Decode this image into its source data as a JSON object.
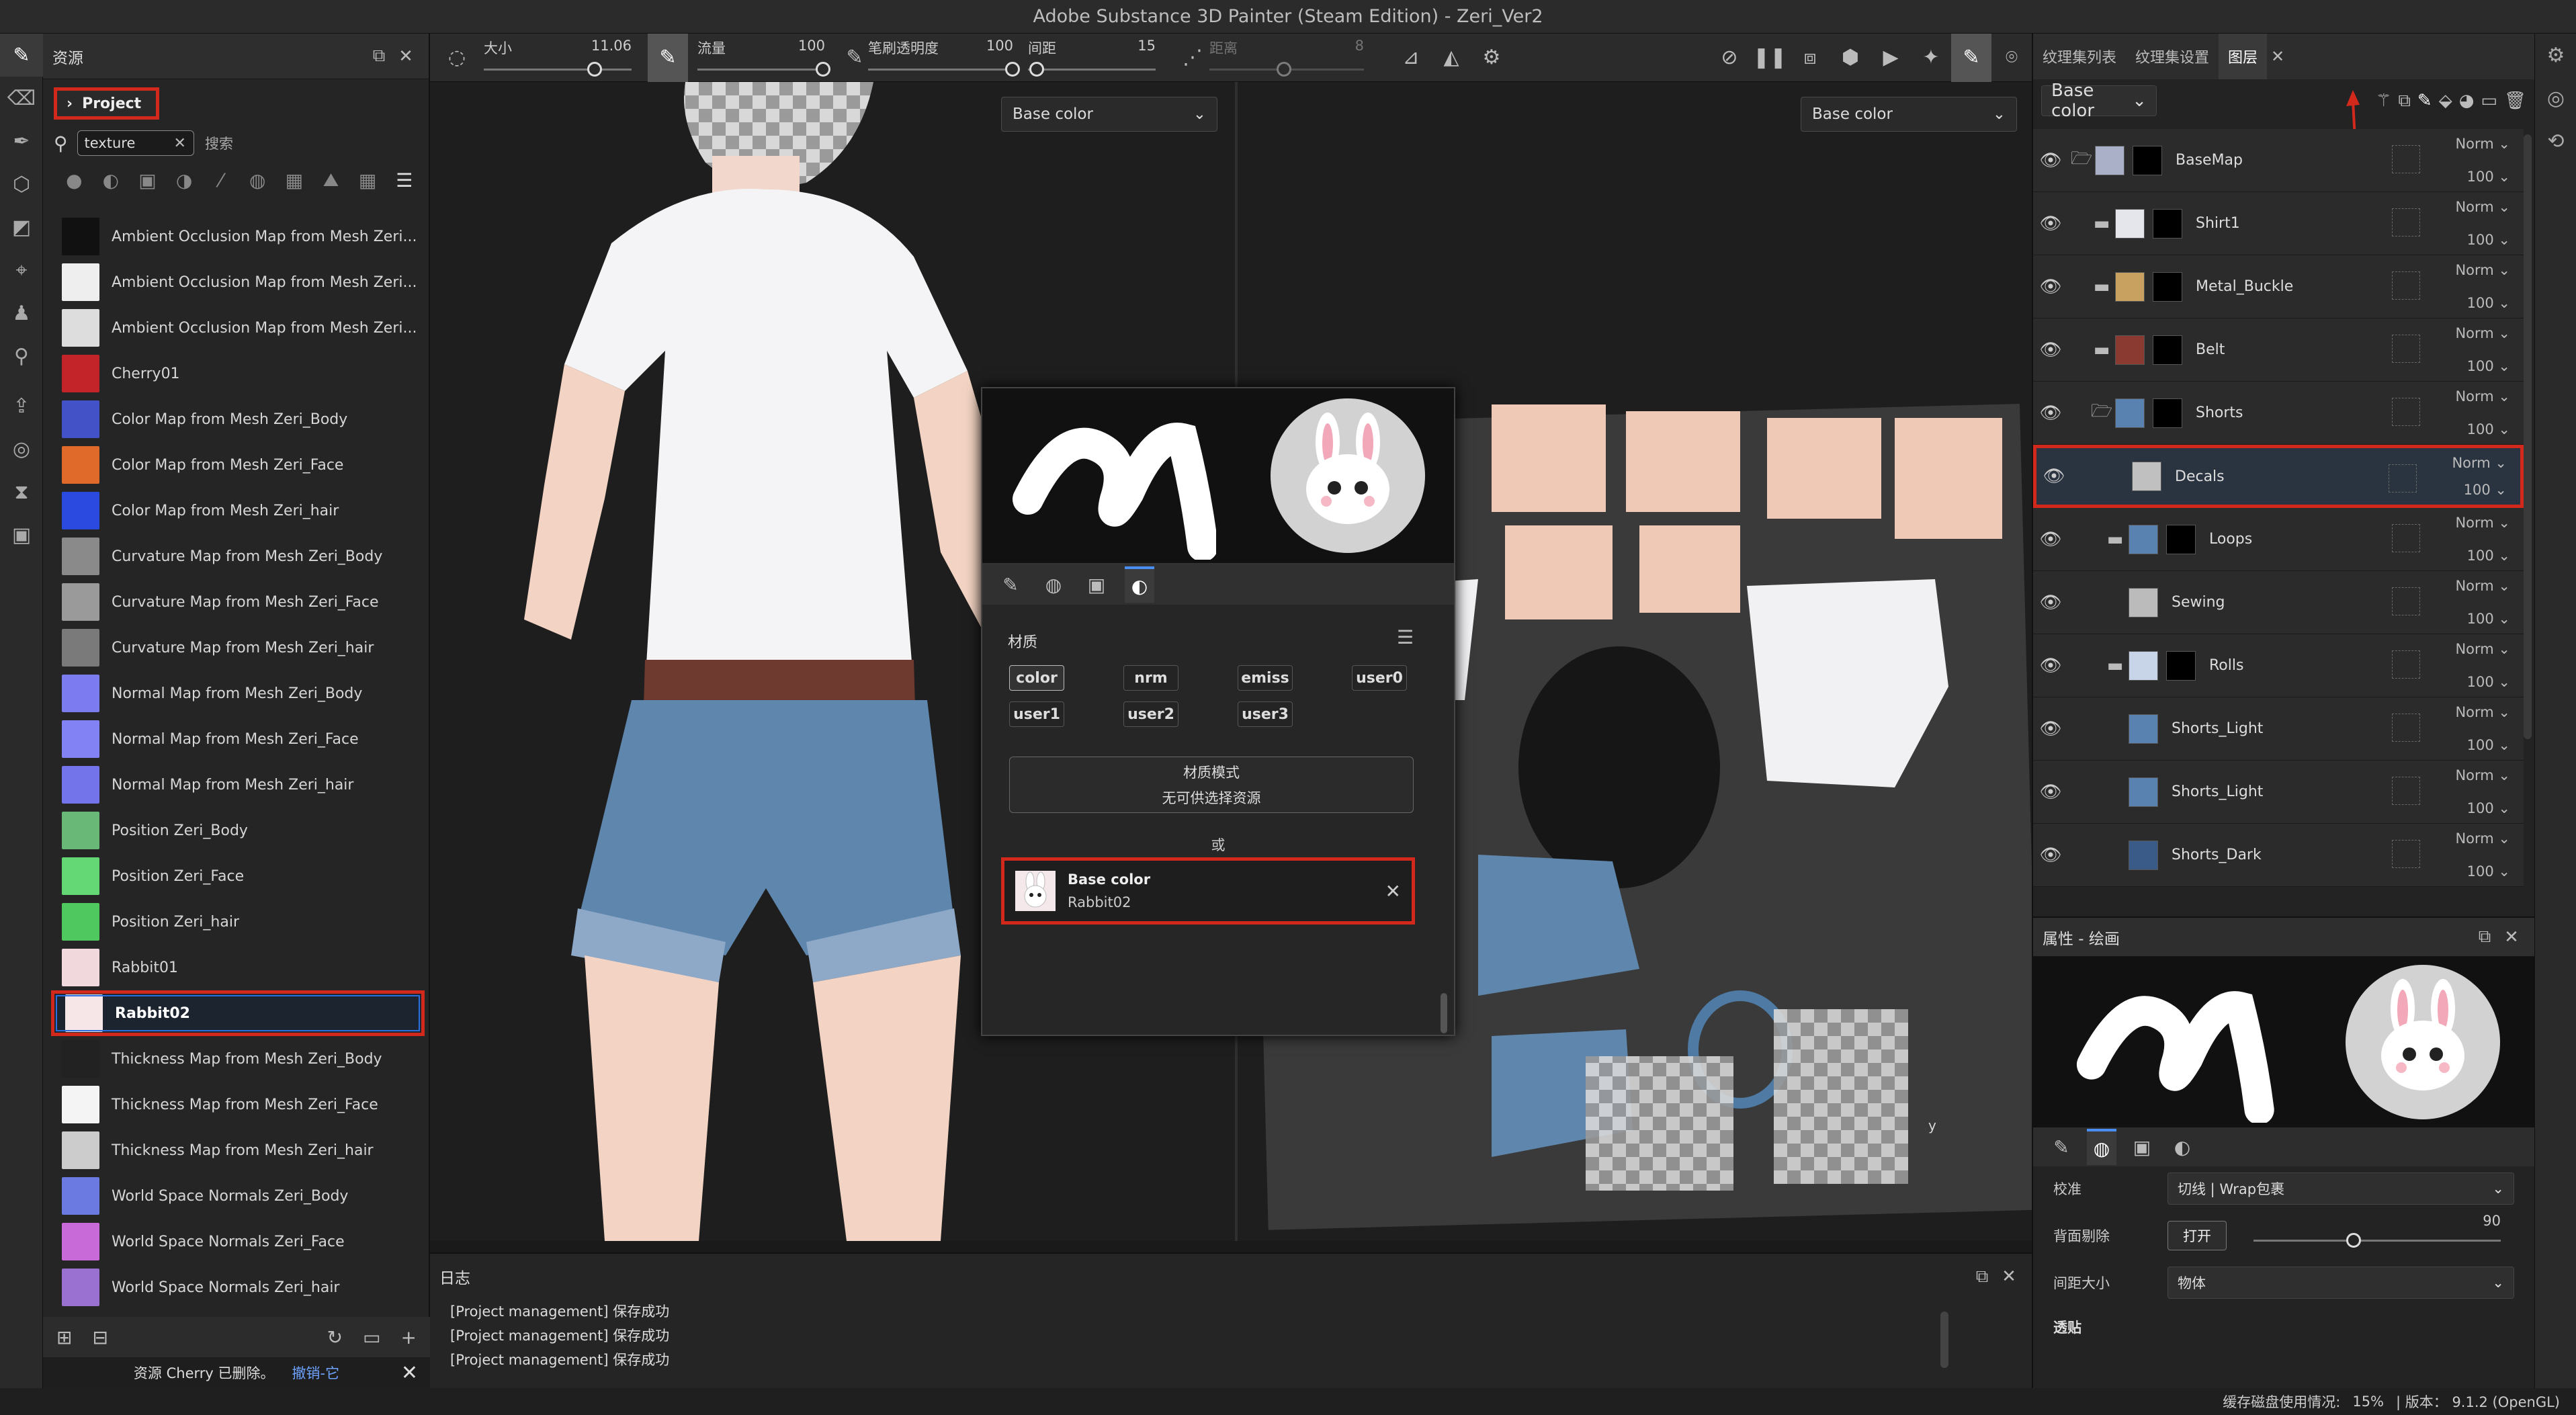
{
  "window": {
    "title": "Adobe Substance 3D Painter (Steam Edition) - Zeri_Ver2"
  },
  "assets": {
    "panel_title": "资源",
    "project_label": "Project",
    "search_value": "texture",
    "search_hint": "搜索",
    "items": [
      {
        "label": "Ambient Occlusion Map from Mesh Zeri...",
        "color": "#111111"
      },
      {
        "label": "Ambient Occlusion Map from Mesh Zeri...",
        "color": "#eeeeee"
      },
      {
        "label": "Ambient Occlusion Map from Mesh Zeri...",
        "color": "#dddddd"
      },
      {
        "label": "Cherry01",
        "color": "#c2242a"
      },
      {
        "label": "Color Map from Mesh Zeri_Body",
        "color": "#4452c8"
      },
      {
        "label": "Color Map from Mesh Zeri_Face",
        "color": "#e06a2a"
      },
      {
        "label": "Color Map from Mesh Zeri_hair",
        "color": "#2a4ae0"
      },
      {
        "label": "Curvature Map from Mesh Zeri_Body",
        "color": "#8a8a8a"
      },
      {
        "label": "Curvature Map from Mesh Zeri_Face",
        "color": "#9a9a9a"
      },
      {
        "label": "Curvature Map from Mesh Zeri_hair",
        "color": "#7a7a7a"
      },
      {
        "label": "Normal Map from Mesh Zeri_Body",
        "color": "#7c7cf0"
      },
      {
        "label": "Normal Map from Mesh Zeri_Face",
        "color": "#8282f4"
      },
      {
        "label": "Normal Map from Mesh Zeri_hair",
        "color": "#7474ea"
      },
      {
        "label": "Position Zeri_Body",
        "color": "#6ab878"
      },
      {
        "label": "Position Zeri_Face",
        "color": "#64d874"
      },
      {
        "label": "Position Zeri_hair",
        "color": "#50c860"
      },
      {
        "label": "Rabbit01",
        "color": "#f0d8dc"
      },
      {
        "label": "Rabbit02",
        "color": "#f6e6e8",
        "selected": true
      },
      {
        "label": "Thickness Map from Mesh Zeri_Body",
        "color": "#222222"
      },
      {
        "label": "Thickness Map from Mesh Zeri_Face",
        "color": "#f4f4f4"
      },
      {
        "label": "Thickness Map from Mesh Zeri_hair",
        "color": "#cccccc"
      },
      {
        "label": "World Space Normals Zeri_Body",
        "color": "#6a7ae0"
      },
      {
        "label": "World Space Normals Zeri_Face",
        "color": "#c86ad8"
      },
      {
        "label": "World Space Normals Zeri_hair",
        "color": "#9a70d0"
      }
    ],
    "toast": "资源 Cherry 已删除。",
    "toast_undo": "撤销-它"
  },
  "toolbar": {
    "size_label": "大小",
    "size_value": "11.06",
    "flow_label": "流量",
    "flow_value": "100",
    "opacity_label": "笔刷透明度",
    "opacity_value": "100",
    "spacing_label": "间距",
    "spacing_value": "15",
    "distance_label": "距离",
    "distance_value": "8"
  },
  "viewport": {
    "left_channel": "Base color",
    "right_channel": "Base color"
  },
  "popup": {
    "section_label": "材质",
    "channels": [
      "color",
      "nrm",
      "emiss",
      "user0",
      "user1",
      "user2",
      "user3"
    ],
    "mode_title": "材质模式",
    "mode_sub": "无可供选择资源",
    "or_label": "或",
    "card_title": "Base color",
    "card_sub": "Rabbit02"
  },
  "log": {
    "title": "日志",
    "lines": [
      "[Project management] 保存成功",
      "[Project management] 保存成功",
      "[Project management] 保存成功"
    ]
  },
  "layers": {
    "tabs": [
      "纹理集列表",
      "纹理集设置",
      "图层"
    ],
    "channel_select": "Base color",
    "items": [
      {
        "name": "BaseMap",
        "blend": "Norm",
        "opacity": "100",
        "thumb": "#aab0c8",
        "folder": "open"
      },
      {
        "name": "Shirt1",
        "blend": "Norm",
        "opacity": "100",
        "thumb": "#e4e6ec",
        "folder": "closed"
      },
      {
        "name": "Metal_Buckle",
        "blend": "Norm",
        "opacity": "100",
        "thumb": "#c8a060",
        "folder": "closed"
      },
      {
        "name": "Belt",
        "blend": "Norm",
        "opacity": "100",
        "thumb": "#8a3a30",
        "folder": "closed"
      },
      {
        "name": "Shorts",
        "blend": "Norm",
        "opacity": "100",
        "thumb": "#5a82b0",
        "folder": "open"
      },
      {
        "name": "Decals",
        "blend": "Norm",
        "opacity": "100",
        "thumb": "#c0c0c0",
        "folder": "none",
        "selected": true
      },
      {
        "name": "Loops",
        "blend": "Norm",
        "opacity": "100",
        "thumb": "#5a82b0",
        "folder": "closed"
      },
      {
        "name": "Sewing",
        "blend": "Norm",
        "opacity": "100",
        "thumb": "#bbbbbb",
        "folder": "none"
      },
      {
        "name": "Rolls",
        "blend": "Norm",
        "opacity": "100",
        "thumb": "#c8d4e8",
        "folder": "closed"
      },
      {
        "name": "Shorts_Light",
        "blend": "Norm",
        "opacity": "100",
        "thumb": "#5a82b0",
        "folder": "none"
      },
      {
        "name": "Shorts_Light",
        "blend": "Norm",
        "opacity": "100",
        "thumb": "#5a82b0",
        "folder": "none"
      },
      {
        "name": "Shorts_Dark",
        "blend": "Norm",
        "opacity": "100",
        "thumb": "#3a5a88",
        "folder": "none"
      }
    ]
  },
  "props": {
    "title": "属性 - 绘画",
    "wrap_label": "校准",
    "wrap_value": "切线 | Wrap包裹",
    "backface_label": "背面剔除",
    "backface_btn": "打开",
    "backface_value": "90",
    "size_label": "间距大小",
    "size_value": "物体",
    "stencil_label": "透贴"
  },
  "status": {
    "text": "缓存磁盘使用情况:",
    "percent": "15%",
    "version": "| 版本： 9.1.2 (OpenGL)"
  }
}
